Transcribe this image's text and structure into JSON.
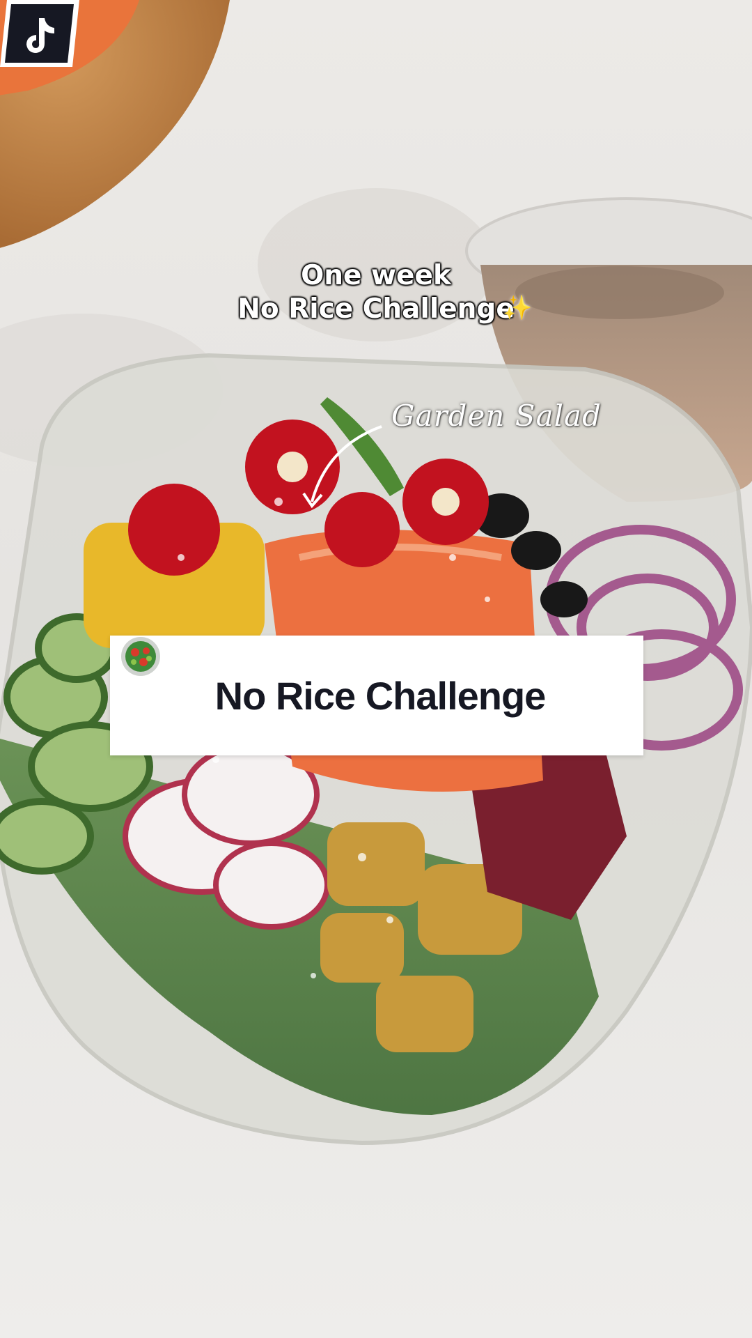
{
  "video": {
    "caption_line1": "One week",
    "caption_line2": "No Rice Challenge",
    "caption_sparkle": "✨",
    "handwritten_label": "Garden Salad"
  },
  "banner": {
    "title": "No Rice Challenge",
    "emoji_icon": "salad-bowl-icon",
    "background": "#ffffff",
    "text_color": "#161823"
  },
  "logo": {
    "icon": "tiktok-logo-icon",
    "background": "#161823"
  }
}
